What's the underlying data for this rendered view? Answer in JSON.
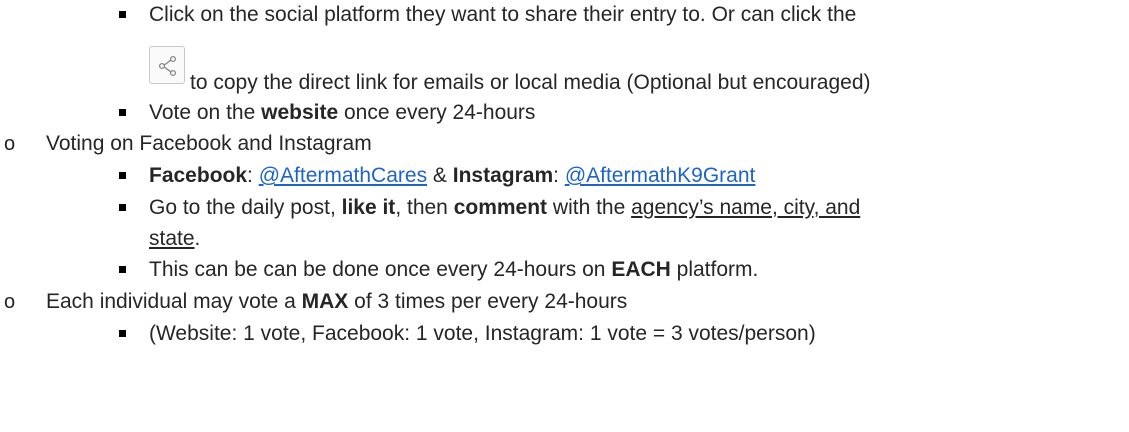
{
  "items": [
    {
      "level": 2,
      "text_before": "Click on the social platform they want to share their entry to. Or can click the",
      "share_icon": "share-icon",
      "continuation": "to copy the direct link for emails or local media (Optional but encouraged)"
    },
    {
      "level": 2,
      "prefix": "Vote on the ",
      "bold": "website",
      "suffix": " once every 24-hours"
    },
    {
      "level": 1,
      "text": "Voting on Facebook and Instagram"
    },
    {
      "level": 2,
      "fb_label": "Facebook",
      "sep1": ": ",
      "fb_link": "@AftermathCares",
      "amp": " & ",
      "ig_label": "Instagram",
      "sep2": ": ",
      "ig_link": "@AftermathK9Grant"
    },
    {
      "level": 2,
      "prefix": "Go to the daily post, ",
      "bold1": "like it",
      "mid": ", then ",
      "bold2": "comment",
      "mid2": " with the ",
      "underline1": "agency’s name, city, and",
      "underline2": "state",
      "suffix": "."
    },
    {
      "level": 2,
      "prefix": "This can be can be done once every 24-hours on ",
      "bold": "EACH",
      "suffix": " platform."
    },
    {
      "level": 1,
      "prefix": "Each individual may vote a ",
      "bold": "MAX",
      "suffix": " of 3 times per every 24-hours"
    },
    {
      "level": 2,
      "text": "(Website: 1 vote, Facebook: 1 vote, Instagram: 1 vote = 3 votes/person)"
    }
  ],
  "bullets": {
    "level1": "o"
  }
}
